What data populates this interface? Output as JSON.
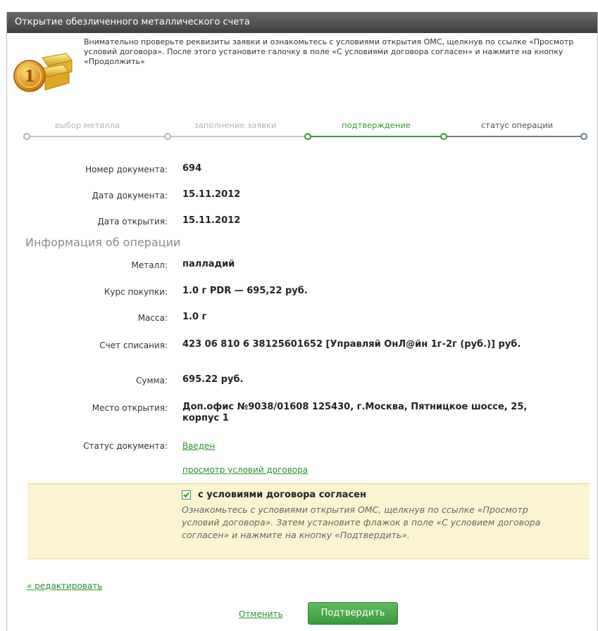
{
  "window": {
    "title": "Открытие обезличенного металлического счета"
  },
  "intro": {
    "text": "Внимательно проверьте реквизиты заявки и ознакомьтесь с условиями открытия ОМС, щелкнув по ссылке «Просмотр условий договора». После этого установите галочку в поле «С условиями договора согласен» и нажмите на кнопку «Продолжить»"
  },
  "steps": [
    {
      "label": "выбор металла",
      "state": "done"
    },
    {
      "label": "заполнение заявки",
      "state": "done"
    },
    {
      "label": "подтверждение",
      "state": "active"
    },
    {
      "label": "статус операции",
      "state": "pending"
    }
  ],
  "document": {
    "number_label": "Номер документа:",
    "number": "694",
    "date_label": "Дата документа:",
    "date": "15.11.2012",
    "open_date_label": "Дата открытия:",
    "open_date": "15.11.2012"
  },
  "operation": {
    "section_title": "Информация об операции",
    "metal_label": "Металл:",
    "metal": "палладий",
    "rate_label": "Курс покупки:",
    "rate": "1.0 г PDR — 695,22 руб.",
    "mass_label": "Масса:",
    "mass": "1.0 г",
    "account_label": "Счет списания:",
    "account": "423 06 810 6 38125601652 [Управляй ОнЛ@йн 1г-2г (руб.)] руб.",
    "sum_label": "Сумма:",
    "sum": "695.22 руб.",
    "place_label": "Место открытия:",
    "place": "Доп.офис №9038/01608 125430, г.Москва, Пятницкое шоссе, 25, корпус 1",
    "status_label": "Статус документа:",
    "status": "Введен",
    "terms_link": "просмотр условий договора"
  },
  "agreement": {
    "checked": true,
    "label": "с условиями договора согласен",
    "hint": "Ознакомьтесь с условиями открытия ОМС, щелкнув по ссылке «Просмотр условий договора». Затем установите флажок в поле «С условием договора согласен» и нажмите на кнопку «Подтвердить»."
  },
  "actions": {
    "edit": "« редактировать",
    "cancel": "Отменить",
    "confirm": "Подтвердить"
  },
  "colors": {
    "active": "#3a9a3a",
    "done": "#b5b5b5",
    "pending": "#6a7f8c",
    "link": "#2f8f2f"
  },
  "icons": {
    "gold": "gold-bars-coin-icon",
    "check": "check-icon"
  }
}
